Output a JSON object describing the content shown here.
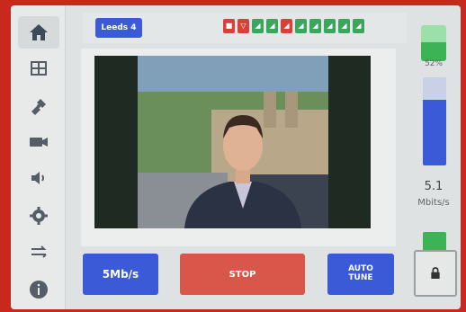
{
  "header": {
    "location_button": "Leeds 4",
    "indicators": [
      {
        "color": "red",
        "glyph": "■"
      },
      {
        "color": "red",
        "glyph": "▽"
      },
      {
        "color": "green",
        "glyph": "◢"
      },
      {
        "color": "green",
        "glyph": "◢"
      },
      {
        "color": "red",
        "glyph": "◢"
      },
      {
        "color": "green",
        "glyph": "◢"
      },
      {
        "color": "green",
        "glyph": "◢"
      },
      {
        "color": "green",
        "glyph": "◢"
      },
      {
        "color": "green",
        "glyph": "◢"
      },
      {
        "color": "green",
        "glyph": "◢"
      }
    ]
  },
  "sidebar": {
    "items": [
      {
        "icon": "home-icon",
        "active": true
      },
      {
        "icon": "grid-icon"
      },
      {
        "icon": "satellite-icon"
      },
      {
        "icon": "camera-icon"
      },
      {
        "icon": "volume-icon"
      },
      {
        "icon": "gear-icon"
      },
      {
        "icon": "transfer-arrows-icon"
      },
      {
        "icon": "info-icon"
      }
    ]
  },
  "controls": {
    "bitrate_label": "5Mb/s",
    "stop_label": "STOP",
    "auto_label_line1": "AUTO",
    "auto_label_line2": "TUNE"
  },
  "status": {
    "battery_percent_text": "52%",
    "battery_level": 0.52,
    "rate_level": 0.75,
    "rate_value": "5.1",
    "rate_unit": "Mbits/s"
  },
  "colors": {
    "accent_blue": "#3a5ad8",
    "stop_red": "#d9564a",
    "ok_green": "#3cb455",
    "bezel_red": "#c8281e"
  }
}
